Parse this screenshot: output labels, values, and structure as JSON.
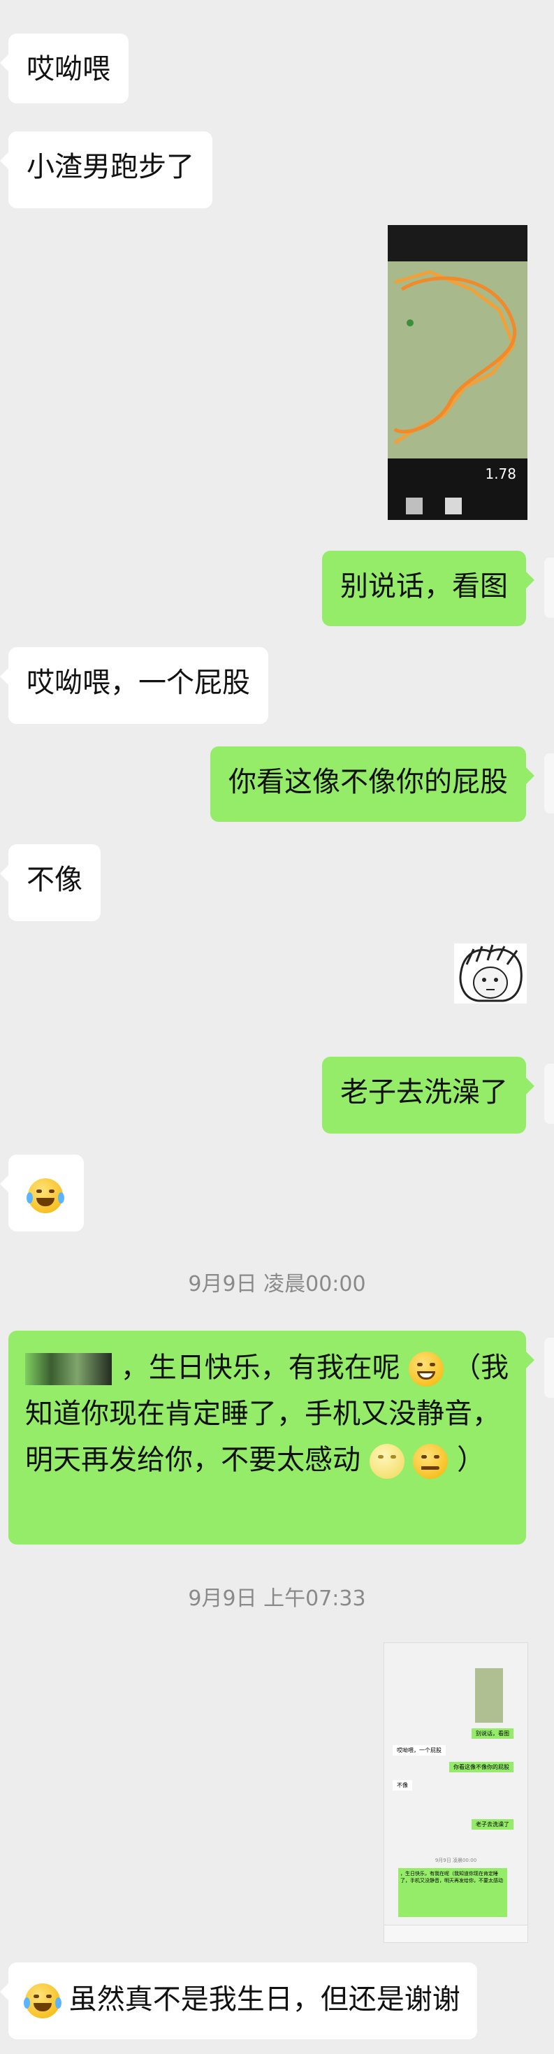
{
  "messages": {
    "m1": "哎呦喂",
    "m2": "小渣男跑步了",
    "m4": "别说话，看图",
    "m5": "哎呦喂，一个屁股",
    "m6": "你看这像不像你的屁股",
    "m7": "不像",
    "m9": "老子去洗澡了",
    "m11_part1": "，生日快乐，有我在呢",
    "m11_part2": "（我知道你现在肯定睡了，手机又没静音，明天再发给你，不要太感动",
    "m11_part3": "）",
    "m13_text": "虽然真不是我生日，但还是谢谢"
  },
  "run_screenshot": {
    "distance_value": "1.78"
  },
  "timestamps": {
    "t1": "9月9日 凌晨00:00",
    "t2": "9月9日 上午07:33"
  },
  "thumbnail": {
    "line1": "别说话，看图",
    "line2": "哎呦喂，一个屁股",
    "line3": "你看这像不像你的屁股",
    "line4": "不像",
    "line5": "老子去洗澡了",
    "line6": "9月9日 凌晨00:00",
    "line7": "，生日快乐，有我在呢（我知道你现在肯定睡了，手机又没静音，明天再发给你，不要太感动"
  },
  "colors": {
    "background": "#ededed",
    "sent_bubble": "#95ec69",
    "received_bubble": "#ffffff",
    "timestamp": "#8a8a8a"
  },
  "icons": {
    "laugh_cry": "face-with-tears-of-joy",
    "grin": "grinning-squinting-face",
    "moon": "full-moon-face",
    "smirk": "smirking-face",
    "sticker": "messy-hair-sticker"
  }
}
